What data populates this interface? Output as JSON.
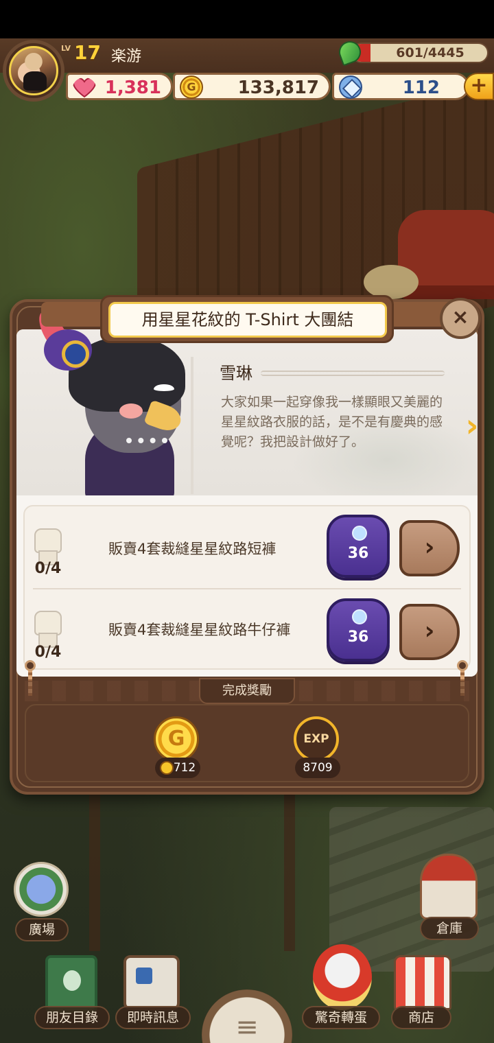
{
  "player": {
    "level_label": "LV",
    "level": "17",
    "name": "楽游"
  },
  "resources": {
    "energy": "601/4445",
    "energy_fraction": 0.135,
    "hearts": "1,381",
    "coins": "133,817",
    "gems": "112",
    "add_label": "+"
  },
  "quest": {
    "title": "用星星花紋的 T-Shirt 大團結",
    "npc_name": "雪琳",
    "dialogue": "大家如果一起穿像我一樣顯眼又美麗的星星紋路衣服的話，是不是有慶典的感覺呢？我把設計做好了。",
    "next_arrow": "›",
    "close": "×",
    "tasks": [
      {
        "progress": "0/4",
        "label": "販賣4套裁縫星星紋路短褲",
        "reward": "36",
        "go": "›"
      },
      {
        "progress": "0/4",
        "label": "販賣4套裁縫星星紋路牛仔褲",
        "reward": "36",
        "go": "›"
      }
    ],
    "completion": {
      "label": "完成獎勵",
      "coin_symbol": "G",
      "coin_amount": "712",
      "exp_symbol": "EXP",
      "exp_amount": "8709"
    }
  },
  "nav": {
    "plaza": "廣場",
    "warehouse": "倉庫",
    "friends": "朋友目錄",
    "messages": "即時訊息",
    "menu": "≡",
    "gacha": "驚奇轉蛋",
    "shop": "商店"
  }
}
